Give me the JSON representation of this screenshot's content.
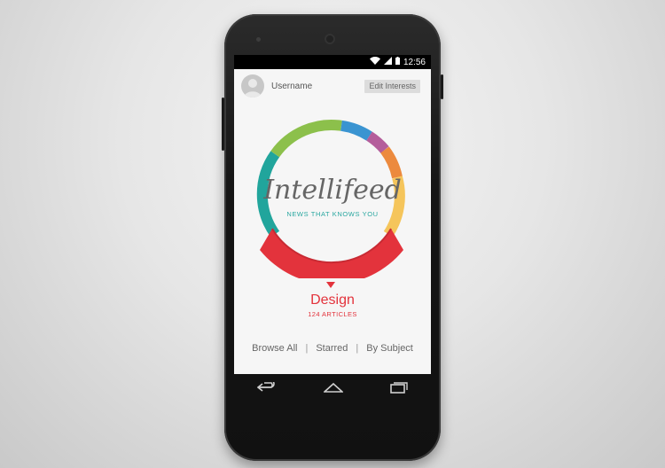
{
  "status_bar": {
    "time": "12:56"
  },
  "header": {
    "username": "Username",
    "edit_button": "Edit Interests"
  },
  "brand": {
    "name": "Intellifeed",
    "tagline": "NEWS THAT KNOWS YOU"
  },
  "selected_topic": {
    "name": "Design",
    "count": "124 ARTICLES"
  },
  "bottom_nav": {
    "items": [
      "Browse All",
      "Starred",
      "By Subject"
    ],
    "separator": "|"
  },
  "colors": {
    "accent": "#e3333c",
    "teal": "#2aa7a0",
    "wheel_segments": [
      "#e3333c",
      "#21a59c",
      "#8cc04b",
      "#3a94d1",
      "#b45d9b",
      "#ec8a3e",
      "#f5c55b"
    ]
  },
  "icons": {
    "status": [
      "wifi-icon",
      "signal-icon",
      "battery-icon"
    ],
    "navigation": [
      "back-icon",
      "home-icon",
      "recents-icon"
    ]
  }
}
